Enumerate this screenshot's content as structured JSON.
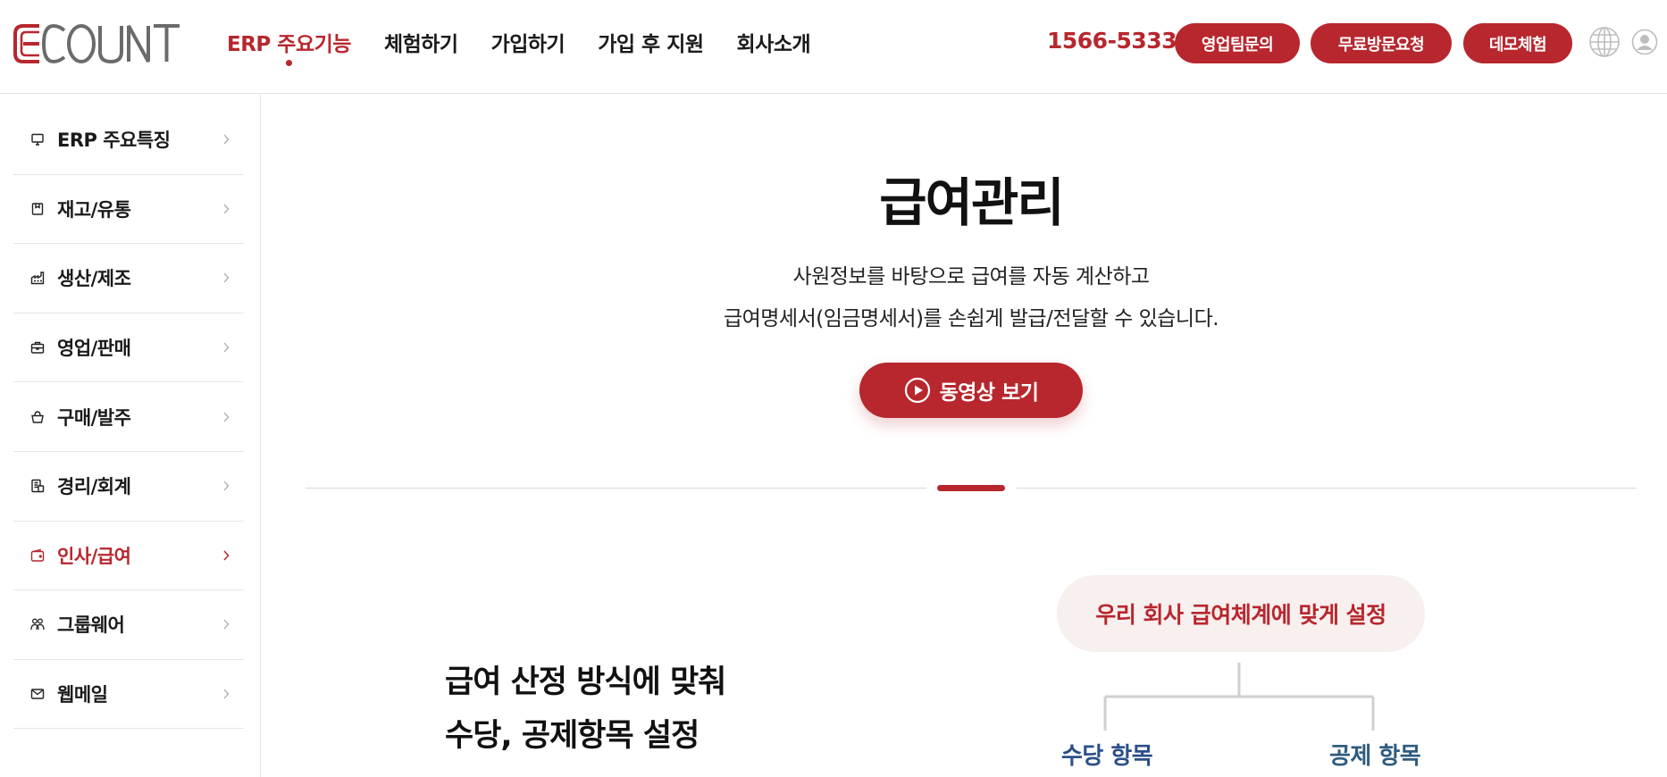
{
  "brand": {
    "logo_text": "ECOUNT",
    "accent_color": "#b7272d",
    "logo_gray": "#6b6b6b"
  },
  "header": {
    "nav": [
      {
        "label": "ERP 주요기능",
        "active": true
      },
      {
        "label": "체험하기",
        "active": false
      },
      {
        "label": "가입하기",
        "active": false
      },
      {
        "label": "가입 후 지원",
        "active": false
      },
      {
        "label": "회사소개",
        "active": false
      }
    ],
    "phone": "1566-5333",
    "buttons": [
      "영업팀문의",
      "무료방문요청",
      "데모체험"
    ],
    "icons": [
      "globe-icon",
      "user-icon"
    ]
  },
  "sidebar": {
    "items": [
      {
        "label": "ERP 주요특징",
        "icon": "monitor-icon",
        "active": false
      },
      {
        "label": "재고/유통",
        "icon": "box-icon",
        "active": false
      },
      {
        "label": "생산/제조",
        "icon": "factory-icon",
        "active": false
      },
      {
        "label": "영업/판매",
        "icon": "briefcase-icon",
        "active": false
      },
      {
        "label": "구매/발주",
        "icon": "basket-icon",
        "active": false
      },
      {
        "label": "경리/회계",
        "icon": "ledger-icon",
        "active": false
      },
      {
        "label": "인사/급여",
        "icon": "wallet-icon",
        "active": true
      },
      {
        "label": "그룹웨어",
        "icon": "people-icon",
        "active": false
      },
      {
        "label": "웹메일",
        "icon": "mail-icon",
        "active": false
      }
    ]
  },
  "main": {
    "title": "급여관리",
    "description": [
      "사원정보를 바탕으로 급여를 자동 계산하고",
      "급여명세서(임금명세서)를 손쉽게 발급/전달할 수 있습니다."
    ],
    "video_button": "동영상 보기",
    "feature": {
      "title_lines": [
        "급여 산정 방식에 맞춰",
        "수당, 공제항목 설정"
      ],
      "diagram": {
        "root": "우리 회사 급여체계에 맞게 설정",
        "children": [
          "수당 항목",
          "공제 항목"
        ]
      }
    }
  }
}
